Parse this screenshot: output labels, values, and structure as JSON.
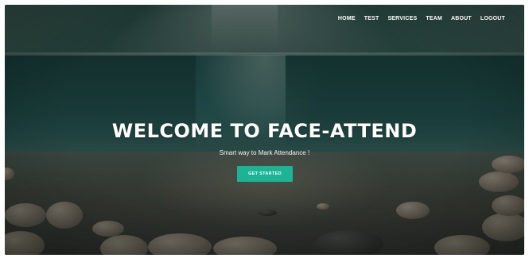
{
  "nav": {
    "items": [
      {
        "label": "HOME"
      },
      {
        "label": "TEST"
      },
      {
        "label": "SERVICES"
      },
      {
        "label": "TEAM"
      },
      {
        "label": "ABOUT"
      },
      {
        "label": "LOGOUT"
      }
    ]
  },
  "hero": {
    "title": "WELCOME TO FACE-ATTEND",
    "subtitle": "Smart way to Mark Attendance !",
    "cta_label": "GET STARTED"
  },
  "colors": {
    "accent": "#1bb494",
    "text": "#ffffff"
  }
}
